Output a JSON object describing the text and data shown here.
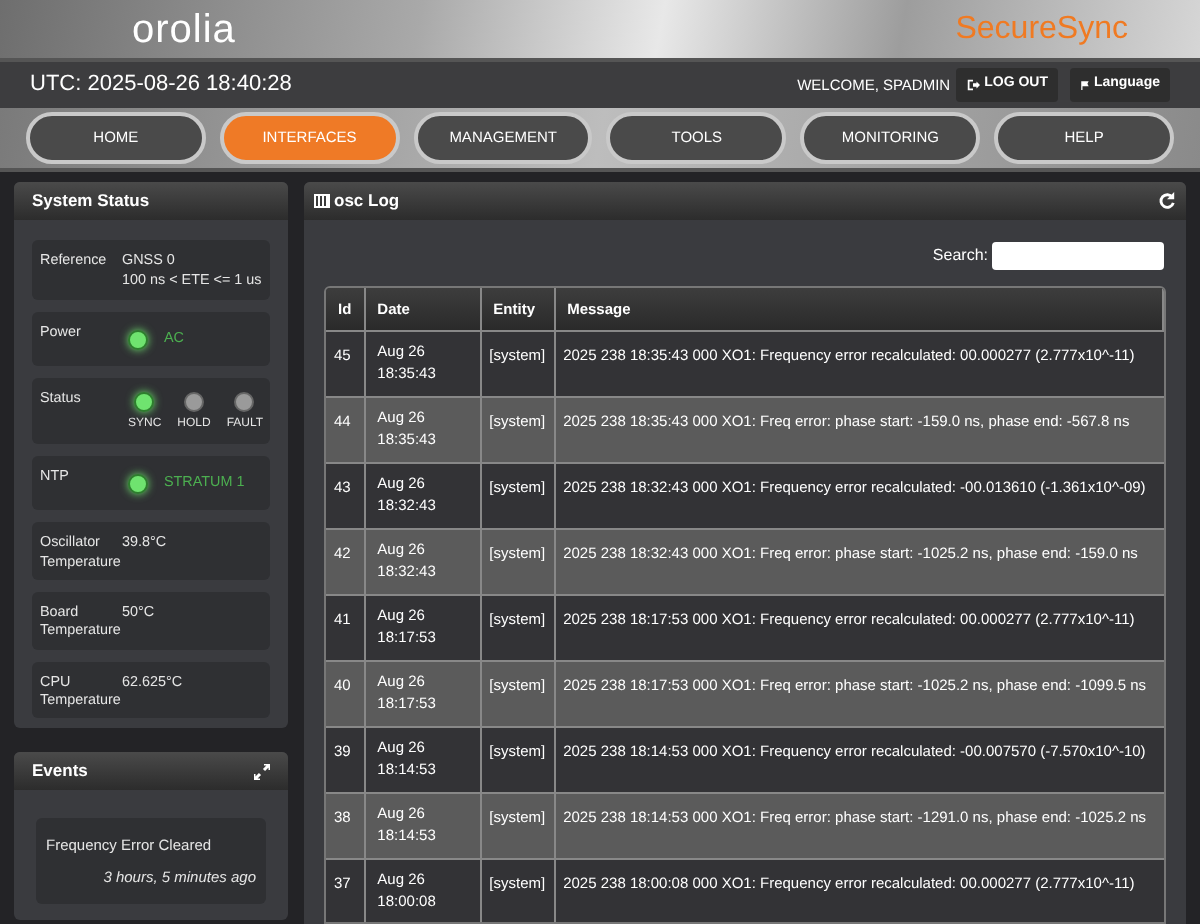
{
  "header": {
    "logo": "orolia",
    "product": "SecureSync"
  },
  "topbar": {
    "clock": "UTC: 2025-08-26 18:40:28",
    "welcome": "WELCOME, SPADMIN",
    "logout": "LOG OUT",
    "language": "Language"
  },
  "nav": [
    {
      "label": "HOME",
      "selected": false
    },
    {
      "label": "INTERFACES",
      "selected": true
    },
    {
      "label": "MANAGEMENT",
      "selected": false
    },
    {
      "label": "TOOLS",
      "selected": false
    },
    {
      "label": "MONITORING",
      "selected": false
    },
    {
      "label": "HELP",
      "selected": false
    }
  ],
  "system_status": {
    "title": "System Status",
    "items": [
      {
        "kind": "text",
        "label": "Reference",
        "lines": [
          "GNSS 0",
          "100 ns < ETE <= 1 us"
        ]
      },
      {
        "kind": "led",
        "label": "Power",
        "value": "AC",
        "on": true
      },
      {
        "kind": "leds",
        "label": "Status",
        "leds": [
          {
            "label": "SYNC",
            "on": true
          },
          {
            "label": "HOLD",
            "on": false
          },
          {
            "label": "FAULT",
            "on": false
          }
        ]
      },
      {
        "kind": "led",
        "label": "NTP",
        "value": "STRATUM 1",
        "on": true
      },
      {
        "kind": "text",
        "label": "Oscillator Temperature",
        "lines": [
          "39.8°C"
        ]
      },
      {
        "kind": "text",
        "label": "Board Temperature",
        "lines": [
          "50°C"
        ]
      },
      {
        "kind": "text",
        "label": "CPU Temperature",
        "lines": [
          "62.625°C"
        ]
      }
    ]
  },
  "events": {
    "title": "Events",
    "items": [
      {
        "text": "Frequency Error Cleared",
        "time": "3 hours, 5 minutes ago"
      }
    ]
  },
  "log": {
    "title": "osc Log",
    "search_label": "Search:",
    "columns": [
      "Id",
      "Date",
      "Entity",
      "Message"
    ],
    "rows": [
      {
        "id": "45",
        "date": "Aug 26",
        "time": "18:35:43",
        "entity": "[system]",
        "message": "2025 238 18:35:43 000 XO1: Frequency error recalculated: 00.000277 (2.777x10^-11)"
      },
      {
        "id": "44",
        "date": "Aug 26",
        "time": "18:35:43",
        "entity": "[system]",
        "message": "2025 238 18:35:43 000 XO1: Freq error: phase start: -159.0 ns, phase end: -567.8 ns"
      },
      {
        "id": "43",
        "date": "Aug 26",
        "time": "18:32:43",
        "entity": "[system]",
        "message": "2025 238 18:32:43 000 XO1: Frequency error recalculated: -00.013610 (-1.361x10^-09)"
      },
      {
        "id": "42",
        "date": "Aug 26",
        "time": "18:32:43",
        "entity": "[system]",
        "message": "2025 238 18:32:43 000 XO1: Freq error: phase start: -1025.2 ns, phase end: -159.0 ns"
      },
      {
        "id": "41",
        "date": "Aug 26",
        "time": "18:17:53",
        "entity": "[system]",
        "message": "2025 238 18:17:53 000 XO1: Frequency error recalculated: 00.000277 (2.777x10^-11)"
      },
      {
        "id": "40",
        "date": "Aug 26",
        "time": "18:17:53",
        "entity": "[system]",
        "message": "2025 238 18:17:53 000 XO1: Freq error: phase start: -1025.2 ns, phase end: -1099.5 ns"
      },
      {
        "id": "39",
        "date": "Aug 26",
        "time": "18:14:53",
        "entity": "[system]",
        "message": "2025 238 18:14:53 000 XO1: Frequency error recalculated: -00.007570 (-7.570x10^-10)"
      },
      {
        "id": "38",
        "date": "Aug 26",
        "time": "18:14:53",
        "entity": "[system]",
        "message": "2025 238 18:14:53 000 XO1: Freq error: phase start: -1291.0 ns, phase end: -1025.2 ns"
      },
      {
        "id": "37",
        "date": "Aug 26",
        "time": "18:00:08",
        "entity": "[system]",
        "message": "2025 238 18:00:08 000 XO1: Frequency error recalculated: 00.000277 (2.777x10^-11)"
      }
    ]
  }
}
